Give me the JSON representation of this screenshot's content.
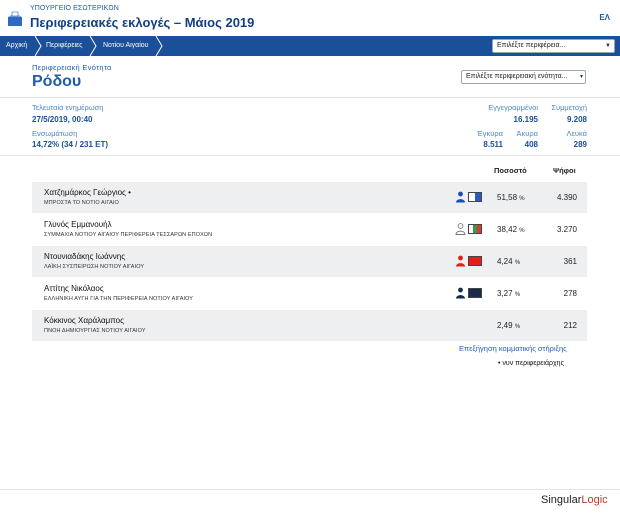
{
  "header": {
    "ministry": "ΥΠΟΥΡΓΕΙΟ ΕΣΩΤΕΡΙΚΩΝ",
    "title": "Περιφερειακές εκλογές – Μάιος 2019",
    "lang": "ΕΛ"
  },
  "breadcrumb": [
    "Αρχική",
    "Περιφέρειες",
    "Νοτίου Αιγαίου"
  ],
  "region_select": {
    "value": "Επιλέξτε περιφέρεια..."
  },
  "unit": {
    "label": "Περιφερειακή Ενότητα",
    "name": "Ρόδου",
    "select_value": "Επιλέξτε περιφερειακή ενότητα..."
  },
  "stats": {
    "last_update_label": "Τελευταία ενημέρωση",
    "last_update_value": "27/5/2019, 00:40",
    "integration_label": "Ενσωμάτωση",
    "integration_value": "14,72% (34 / 231 ΕΤ)",
    "registered_label": "Εγγεγραμμένοι",
    "registered_value": "16.195",
    "turnout_label": "Συμμετοχή",
    "turnout_value": "9.208",
    "valid_label": "Έγκυρα",
    "valid_value": "8.511",
    "invalid_label": "Άκυρα",
    "invalid_value": "408",
    "blank_label": "Λευκά",
    "blank_value": "289"
  },
  "table": {
    "col_percent": "Ποσοστό",
    "col_votes": "Ψήφοι",
    "rows": [
      {
        "name": "Χατζημάρκος Γεώργιος •",
        "party": "ΜΠΡΟΣΤΑ ΤΟ ΝΟΤΙΟ ΑΙΓΑΙΟ",
        "percent": "51,58",
        "votes": "4.390",
        "icon": "person-icon",
        "icon_color": "#1a4fb0",
        "swatch_colors": [
          "#ffffff",
          "#2a5cc0"
        ],
        "shaded": true
      },
      {
        "name": "Γλυνός Εμμανουήλ",
        "party": "ΣΥΜΜΑΧΙΑ ΝΟΤΙΟΥ ΑΙΓΑΙΟΥ ΠΕΡΙΦΕΡΕΙΑ ΤΕΣΣΑΡΩΝ ΕΠΟΧΩΝ",
        "percent": "38,42",
        "votes": "3.270",
        "icon": "person-outline-icon",
        "icon_color": "#777777",
        "swatch_colors": [
          "#ffffff",
          "#3a9a3a",
          "#d63a3a"
        ],
        "shaded": false
      },
      {
        "name": "Ντουνιαδάκης Ιωάννης",
        "party": "ΛΑΪΚΗ ΣΥΣΠΕΙΡΩΣΗ ΝΟΤΙΟΥ ΑΙΓΑΙΟΥ",
        "percent": "4,24",
        "votes": "361",
        "icon": "person-icon",
        "icon_color": "#e0201a",
        "swatch_colors": [
          "#e0201a"
        ],
        "shaded": true
      },
      {
        "name": "Αττίτης Νικόλαος",
        "party": "ΕΛΛΗΝΙΚΗ ΑΥΓΗ ΓΙΑ ΤΗΝ ΠΕΡΙΦΕΡΕΙΑ ΝΟΤΙΟΥ ΑΙΓΑΙΟΥ",
        "percent": "3,27",
        "votes": "278",
        "icon": "person-icon",
        "icon_color": "#1a2a4a",
        "swatch_colors": [
          "#1a2a4a"
        ],
        "shaded": false
      },
      {
        "name": "Κόκκινος Χαράλαμπος",
        "party": "ΠΝΟΗ ΔΗΜΙΟΥΡΓΙΑΣ ΝΟΤΙΟΥ ΑΙΓΑΙΟΥ",
        "percent": "2,49",
        "votes": "212",
        "icon": "",
        "icon_color": "",
        "swatch_colors": [],
        "shaded": true
      }
    ],
    "percent_unit": "%"
  },
  "support_link": "Επεξήγηση κομματικής στήριξης",
  "footnote": "• νυν περιφερειάρχης",
  "footer": {
    "brand_part1": "Singular",
    "brand_part2": "Logic"
  }
}
